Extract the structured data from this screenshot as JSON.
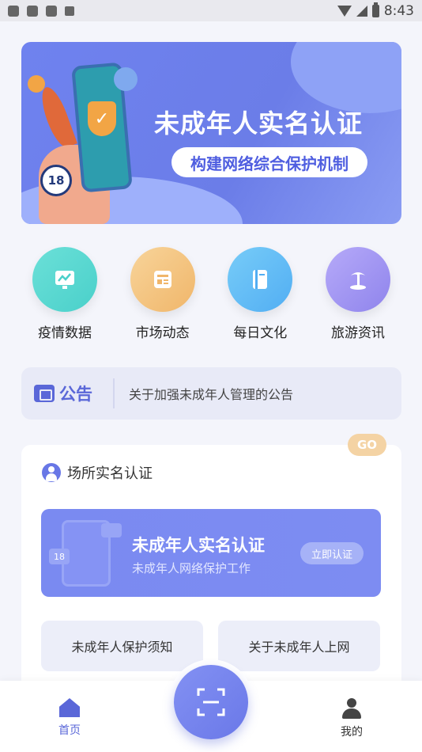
{
  "status_bar": {
    "time": "8:43"
  },
  "banner": {
    "title": "未成年人实名认证",
    "subtitle": "构建网络综合保护机制",
    "badge": "18"
  },
  "grid": [
    {
      "label": "疫情数据",
      "icon": "chart-icon",
      "color": "#4ad0ca"
    },
    {
      "label": "市场动态",
      "icon": "news-icon",
      "color": "#f0b66a"
    },
    {
      "label": "每日文化",
      "icon": "book-icon",
      "color": "#52aef3"
    },
    {
      "label": "旅游资讯",
      "icon": "palm-tree-icon",
      "color": "#8f84ec"
    }
  ],
  "notice": {
    "tag": "公告",
    "text": "关于加强未成年人管理的公告"
  },
  "card": {
    "go_label": "GO",
    "title": "场所实名认证",
    "verify": {
      "title": "未成年人实名认证",
      "subtitle": "未成年人网络保护工作",
      "button": "立即认证",
      "deco_badge": "18"
    },
    "links": [
      "未成年人保护须知",
      "关于未成年人上网"
    ]
  },
  "bottom_nav": {
    "home_label": "首页",
    "mine_label": "我的"
  },
  "colors": {
    "accent": "#5a67d8",
    "banner": "#6f82ef",
    "go": "#f4d3a4"
  }
}
